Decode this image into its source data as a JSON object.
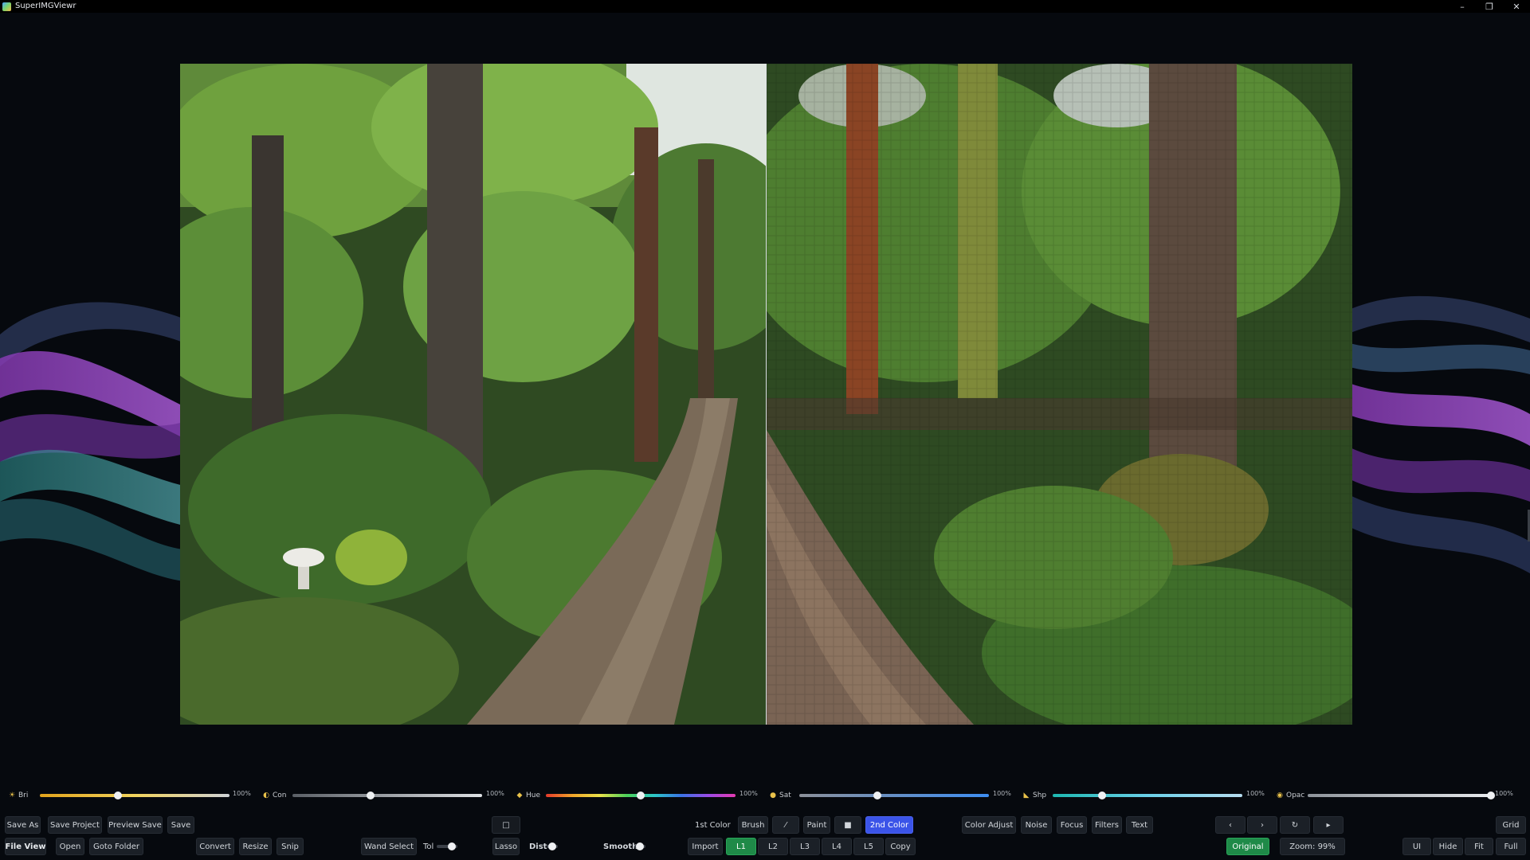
{
  "window": {
    "title": "SuperIMGViewr",
    "controls": {
      "minimize": "–",
      "restore": "❐",
      "close": "✕"
    }
  },
  "sliders": [
    {
      "key": "bri",
      "icon": "☀",
      "label": "Bri",
      "value": "100%",
      "fraction": 0.41,
      "track": "linear-gradient(90deg,#e2a31c,#f1d35c,#cfd3d8)"
    },
    {
      "key": "con",
      "icon": "◐",
      "label": "Con",
      "value": "100%",
      "fraction": 0.41,
      "track": "linear-gradient(90deg,#5a5f66,#dfe2e5)"
    },
    {
      "key": "hue",
      "icon": "◆",
      "label": "Hue",
      "value": "100%",
      "fraction": 0.5,
      "track": "linear-gradient(90deg,#e53a2b,#f1a62a,#e9e24a,#4bd05a,#2cc7c7,#3a73e6,#9a4be6,#e53ab0)"
    },
    {
      "key": "sat",
      "icon": "●",
      "label": "Sat",
      "value": "100%",
      "fraction": 0.41,
      "track": "linear-gradient(90deg,#8c9099,#3d8ef2)"
    },
    {
      "key": "shp",
      "icon": "◣",
      "label": "Shp",
      "value": "100%",
      "fraction": 0.26,
      "track": "linear-gradient(90deg,#1db7b0,#6ad0e8,#b6dcef)"
    },
    {
      "key": "opac",
      "icon": "◉",
      "label": "Opac",
      "value": "100%",
      "fraction": 1.0,
      "track": "linear-gradient(90deg,#8d939a,#e7eaed)"
    }
  ],
  "toolbar": {
    "row1_left": [
      "Save As",
      "Save Project",
      "Preview Save",
      "Save"
    ],
    "selection_box": "□",
    "color1": "1st Color",
    "brush": "Brush",
    "line": "⁄",
    "paint": "Paint",
    "fill": "■",
    "color2": "2nd Color",
    "effects": [
      "Color Adjust",
      "Noise",
      "Focus",
      "Filters",
      "Text"
    ],
    "nav_prev": "‹",
    "nav_next": "›",
    "rotate": "↻",
    "play": "▸",
    "grid": "Grid",
    "row2_left": [
      "File View",
      "Open",
      "Goto Folder"
    ],
    "row2_tools": [
      "Convert",
      "Resize",
      "Snip"
    ],
    "wand": "Wand Select",
    "tol": "Tol",
    "lasso": "Lasso",
    "dist": "Dist",
    "smooth": "Smooth",
    "import": "Import",
    "layers": [
      "L1",
      "L2",
      "L3",
      "L4",
      "L5"
    ],
    "copy": "Copy",
    "original": "Original",
    "zoom": "Zoom: 99%",
    "view_right": [
      "UI",
      "Hide",
      "Fit",
      "Full"
    ]
  },
  "colors": {
    "accent_green": "#1f8a48",
    "accent_blue": "#3b54e8",
    "background": "#06090e"
  }
}
